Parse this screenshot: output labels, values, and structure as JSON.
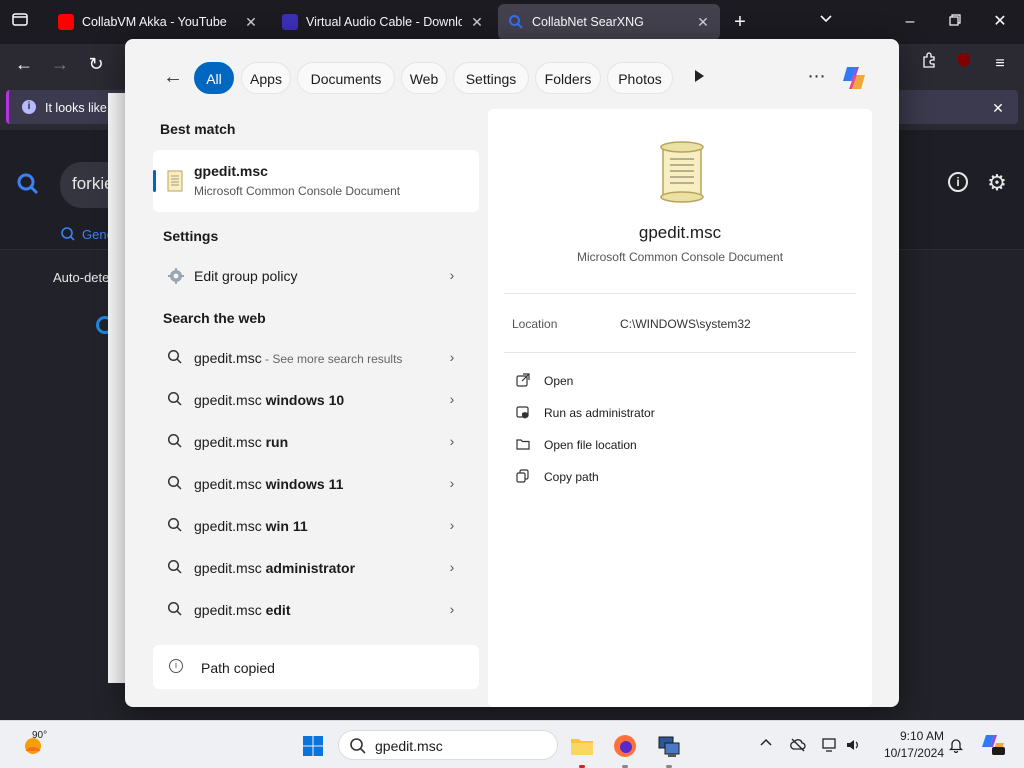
{
  "browser": {
    "tabs": [
      {
        "title": "CollabVM Akka - YouTube",
        "favicon": "youtube-icon",
        "active": false
      },
      {
        "title": "Virtual Audio Cable - Download",
        "favicon": "vac-icon",
        "active": false
      },
      {
        "title": "CollabNet SearXNG",
        "favicon": "search-icon",
        "active": true
      }
    ],
    "notification_text": "It looks like",
    "page": {
      "query_text": "forkie",
      "tab_general": "Gene",
      "auto_detect": "Auto-dete"
    }
  },
  "start_search": {
    "filters": [
      {
        "label": "All",
        "active": true
      },
      {
        "label": "Apps",
        "active": false
      },
      {
        "label": "Documents",
        "active": false
      },
      {
        "label": "Web",
        "active": false
      },
      {
        "label": "Settings",
        "active": false
      },
      {
        "label": "Folders",
        "active": false
      },
      {
        "label": "Photos",
        "active": false
      }
    ],
    "best_match": {
      "section_title": "Best match",
      "name": "gpedit.msc",
      "type": "Microsoft Common Console Document"
    },
    "settings": {
      "section_title": "Settings",
      "items": [
        {
          "label": "Edit group policy"
        }
      ]
    },
    "web": {
      "section_title": "Search the web",
      "items": [
        {
          "prefix": "gpedit.msc",
          "suffix": "",
          "muted": " - See more search results"
        },
        {
          "prefix": "gpedit.msc ",
          "suffix": "windows 10",
          "muted": ""
        },
        {
          "prefix": "gpedit.msc ",
          "suffix": "run",
          "muted": ""
        },
        {
          "prefix": "gpedit.msc ",
          "suffix": "windows 11",
          "muted": ""
        },
        {
          "prefix": "gpedit.msc ",
          "suffix": "win 11",
          "muted": ""
        },
        {
          "prefix": "gpedit.msc ",
          "suffix": "administrator",
          "muted": ""
        },
        {
          "prefix": "gpedit.msc ",
          "suffix": "edit",
          "muted": ""
        }
      ]
    },
    "status_text": "Path copied",
    "preview": {
      "name": "gpedit.msc",
      "type": "Microsoft Common Console Document",
      "location_label": "Location",
      "location_value": "C:\\WINDOWS\\system32",
      "actions": [
        {
          "label": "Open",
          "icon": "open-external-icon"
        },
        {
          "label": "Run as administrator",
          "icon": "shield-admin-icon"
        },
        {
          "label": "Open file location",
          "icon": "folder-icon"
        },
        {
          "label": "Copy path",
          "icon": "copy-icon"
        }
      ]
    }
  },
  "taskbar": {
    "weather_temp": "90°",
    "search_text": "gpedit.msc",
    "time": "9:10 AM",
    "date": "10/17/2024"
  },
  "colors": {
    "accent": "#0067c0",
    "browser_bg": "#1c1b22",
    "taskbar_bg": "#eef0f4"
  }
}
